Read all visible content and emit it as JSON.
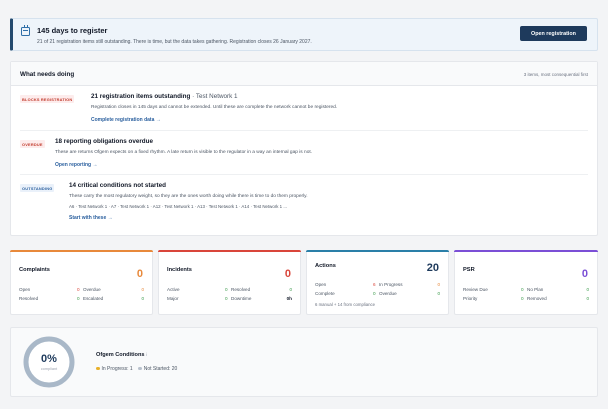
{
  "banner": {
    "title": "145 days to register",
    "subtitle": "21 of 21 registration items still outstanding. There is time, but the data takes gathering. Registration closes 26 January 2027.",
    "button": "Open registration"
  },
  "needs": {
    "heading": "What needs doing",
    "meta": "3 items, most consequential first",
    "items": [
      {
        "badge": "BLOCKS REGISTRATION",
        "title": "21 registration items outstanding",
        "network": " · Test Network 1",
        "desc": "Registration closes in 145 days and cannot be extended. Until these are complete the network cannot be registered.",
        "link": "Complete registration data →"
      },
      {
        "badge": "OVERDUE",
        "title": "18 reporting obligations overdue",
        "desc": "These are returns Ofgem expects on a fixed rhythm. A late return is visible to the regulator in a way an internal gap is not.",
        "link": "Open reporting →"
      },
      {
        "badge": "OUTSTANDING",
        "title": "14 critical conditions not started",
        "desc": "These carry the most regulatory weight, so they are the ones worth doing while there is time to do them properly.",
        "refs": "A6 · Test Network 1 · A7 · Test Network 1 · A12 · Test Network 1 · A13 · Test Network 1 · A14 · Test Network 1 ...",
        "link": "Start with these →"
      }
    ]
  },
  "cards": {
    "complaints": {
      "title": "Complaints",
      "total": "0",
      "open_label": "Open",
      "open_val": "0",
      "overdue_label": "Overdue",
      "overdue_val": "0",
      "resolved_label": "Resolved",
      "resolved_val": "0",
      "escalated_label": "Escalated",
      "escalated_val": "0"
    },
    "incidents": {
      "title": "Incidents",
      "total": "0",
      "active_label": "Active",
      "active_val": "0",
      "resolved_label": "Resolved",
      "resolved_val": "0",
      "major_label": "Major",
      "major_val": "0",
      "downtime_label": "Downtime",
      "downtime_val": "0h"
    },
    "actions": {
      "title": "Actions",
      "total": "20",
      "open_label": "Open",
      "open_val": "6",
      "inprog_label": "In Progress",
      "inprog_val": "0",
      "complete_label": "Complete",
      "complete_val": "0",
      "overdue_label": "Overdue",
      "overdue_val": "0",
      "note": "6 manual + 14 from compliance"
    },
    "psr": {
      "title": "PSR",
      "total": "0",
      "review_label": "Review Due",
      "review_val": "0",
      "noplan_label": "No Plan",
      "noplan_val": "0",
      "priority_label": "Priority",
      "priority_val": "0",
      "removed_label": "Removed",
      "removed_val": "0"
    }
  },
  "conditions": {
    "percent": "0%",
    "percent_label": "compliant",
    "title": "Ofgem Conditions",
    "info": "i",
    "in_progress": "In Progress: 1",
    "not_started": "Not Started: 20"
  },
  "colors": {
    "navy": "#1e3a5c",
    "complaints": "#e8893b",
    "incidents": "#d9453a",
    "actions": "#2a7fa8",
    "psr": "#7b4fd6"
  }
}
